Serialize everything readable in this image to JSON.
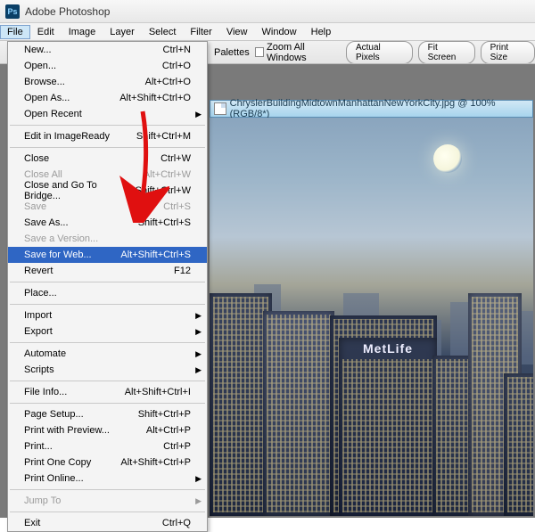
{
  "app": {
    "title": "Adobe Photoshop"
  },
  "menubar": [
    "File",
    "Edit",
    "Image",
    "Layer",
    "Select",
    "Filter",
    "View",
    "Window",
    "Help"
  ],
  "toolbar": {
    "palettes_label": "Palettes",
    "zoom_all_label": "Zoom All Windows",
    "actual_pixels": "Actual Pixels",
    "fit_screen": "Fit Screen",
    "print_size": "Print Size"
  },
  "document": {
    "title": "ChryslerBuildingMidtownManhattanNewYorkCity.jpg @ 100% (RGB/8*)",
    "metlife_sign": "MetLife"
  },
  "file_menu": [
    {
      "type": "item",
      "label": "New...",
      "shortcut": "Ctrl+N"
    },
    {
      "type": "item",
      "label": "Open...",
      "shortcut": "Ctrl+O"
    },
    {
      "type": "item",
      "label": "Browse...",
      "shortcut": "Alt+Ctrl+O"
    },
    {
      "type": "item",
      "label": "Open As...",
      "shortcut": "Alt+Shift+Ctrl+O"
    },
    {
      "type": "submenu",
      "label": "Open Recent"
    },
    {
      "type": "sep"
    },
    {
      "type": "item",
      "label": "Edit in ImageReady",
      "shortcut": "Shift+Ctrl+M"
    },
    {
      "type": "sep"
    },
    {
      "type": "item",
      "label": "Close",
      "shortcut": "Ctrl+W"
    },
    {
      "type": "item",
      "label": "Close All",
      "shortcut": "Alt+Ctrl+W",
      "disabled": true
    },
    {
      "type": "item",
      "label": "Close and Go To Bridge...",
      "shortcut": "Shift+Ctrl+W"
    },
    {
      "type": "item",
      "label": "Save",
      "shortcut": "Ctrl+S",
      "disabled": true
    },
    {
      "type": "item",
      "label": "Save As...",
      "shortcut": "Shift+Ctrl+S"
    },
    {
      "type": "item",
      "label": "Save a Version...",
      "disabled": true
    },
    {
      "type": "item",
      "label": "Save for Web...",
      "shortcut": "Alt+Shift+Ctrl+S",
      "highlight": true
    },
    {
      "type": "item",
      "label": "Revert",
      "shortcut": "F12"
    },
    {
      "type": "sep"
    },
    {
      "type": "item",
      "label": "Place..."
    },
    {
      "type": "sep"
    },
    {
      "type": "submenu",
      "label": "Import"
    },
    {
      "type": "submenu",
      "label": "Export"
    },
    {
      "type": "sep"
    },
    {
      "type": "submenu",
      "label": "Automate"
    },
    {
      "type": "submenu",
      "label": "Scripts"
    },
    {
      "type": "sep"
    },
    {
      "type": "item",
      "label": "File Info...",
      "shortcut": "Alt+Shift+Ctrl+I"
    },
    {
      "type": "sep"
    },
    {
      "type": "item",
      "label": "Page Setup...",
      "shortcut": "Shift+Ctrl+P"
    },
    {
      "type": "item",
      "label": "Print with Preview...",
      "shortcut": "Alt+Ctrl+P"
    },
    {
      "type": "item",
      "label": "Print...",
      "shortcut": "Ctrl+P"
    },
    {
      "type": "item",
      "label": "Print One Copy",
      "shortcut": "Alt+Shift+Ctrl+P"
    },
    {
      "type": "submenu",
      "label": "Print Online..."
    },
    {
      "type": "sep"
    },
    {
      "type": "submenu",
      "label": "Jump To",
      "disabled": true
    },
    {
      "type": "sep"
    },
    {
      "type": "item",
      "label": "Exit",
      "shortcut": "Ctrl+Q"
    }
  ]
}
